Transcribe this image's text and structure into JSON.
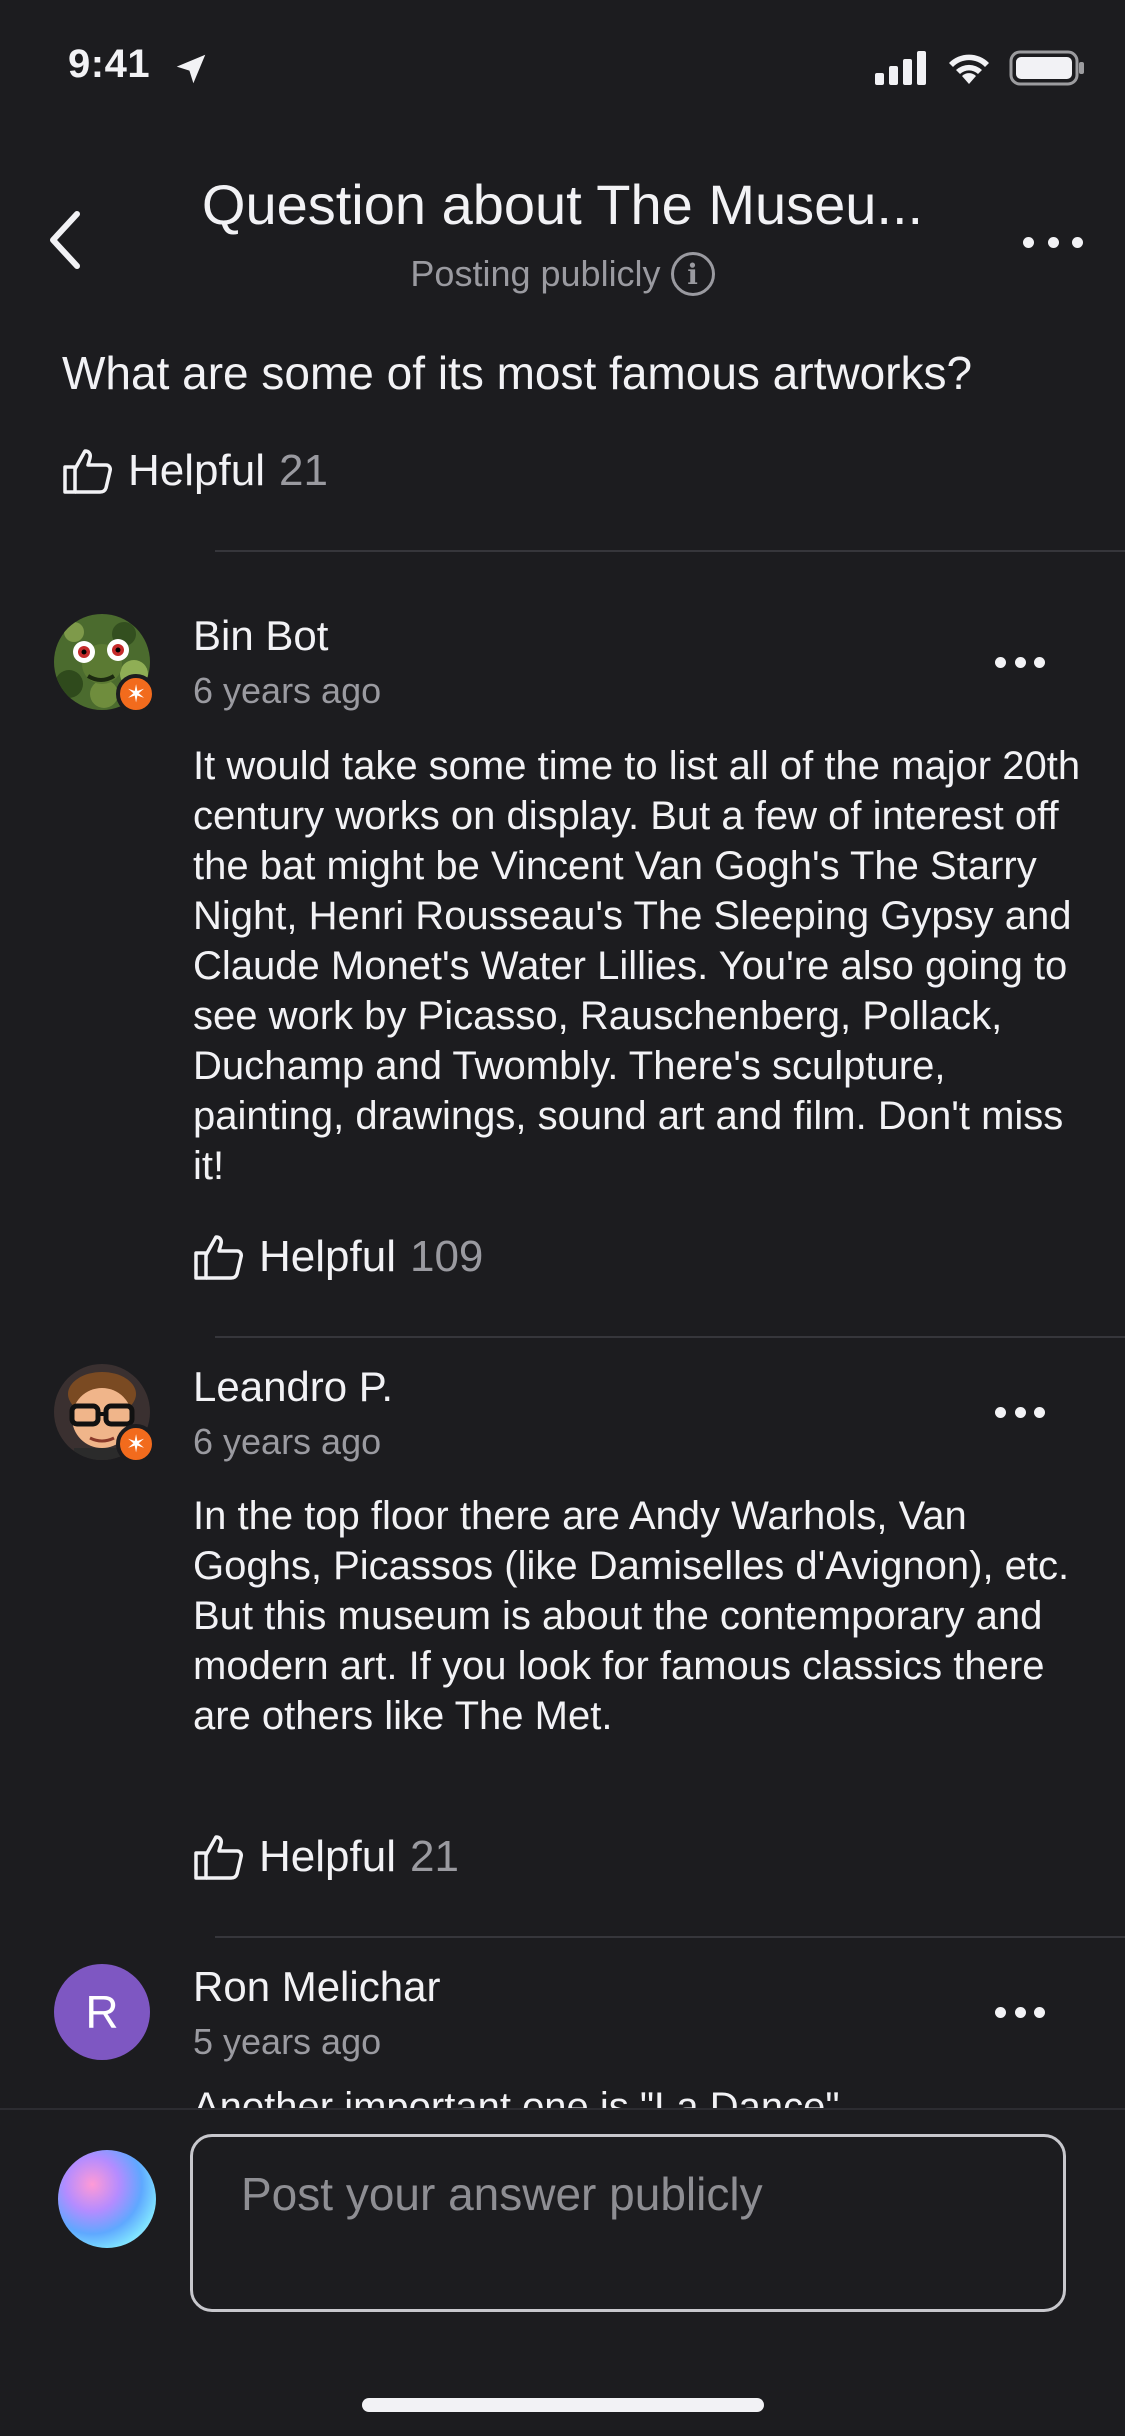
{
  "status_bar": {
    "time": "9:41"
  },
  "header": {
    "title": "Question about The Museu...",
    "subtitle": "Posting publicly",
    "info_glyph": "i"
  },
  "question": {
    "text": "What are some of its most famous artworks?",
    "helpful_label": "Helpful",
    "helpful_count": "21"
  },
  "answers": [
    {
      "author": "Bin Bot",
      "time": "6 years ago",
      "body": "It would take some time to list all of the major 20th century works on display. But a few of interest off the bat might be Vincent Van Gogh's The Starry Night,  Henri Rousseau's The Sleeping Gypsy and Claude Monet's Water Lillies. You're also going to see work by Picasso, Rauschenberg, Pollack, Duchamp and Twombly. There's sculpture, painting, drawings, sound art and film. Don't miss it!",
      "helpful_label": "Helpful",
      "helpful_count": "109",
      "badge": "✶"
    },
    {
      "author": "Leandro P.",
      "time": "6 years ago",
      "body": "In the top floor there are Andy Warhols, Van Goghs, Picassos (like Damiselles d'Avignon), etc. But this museum is about the contemporary and modern art. If you look for famous classics there are others like The Met.",
      "helpful_label": "Helpful",
      "helpful_count": "21",
      "badge": "✶"
    },
    {
      "author": "Ron Melichar",
      "time": "5 years ago",
      "avatar_letter": "R",
      "avatar_color": "#7e57c2",
      "body_preview": "Another important one is \"La Dance\""
    }
  ],
  "composer": {
    "placeholder": "Post your answer publicly"
  },
  "colors": {
    "background": "#1c1c1f",
    "text": "#f2f2f5",
    "muted": "#9a9aa0",
    "badge": "#f26b1d",
    "divider": "#36363b"
  },
  "icons": {
    "back": "chevron-left-icon",
    "more": "more-horizontal-icon",
    "helpful": "thumbs-up-icon",
    "info": "info-icon",
    "location": "location-arrow-icon",
    "signal": "cellular-signal-icon",
    "wifi": "wifi-icon",
    "battery": "battery-icon"
  }
}
